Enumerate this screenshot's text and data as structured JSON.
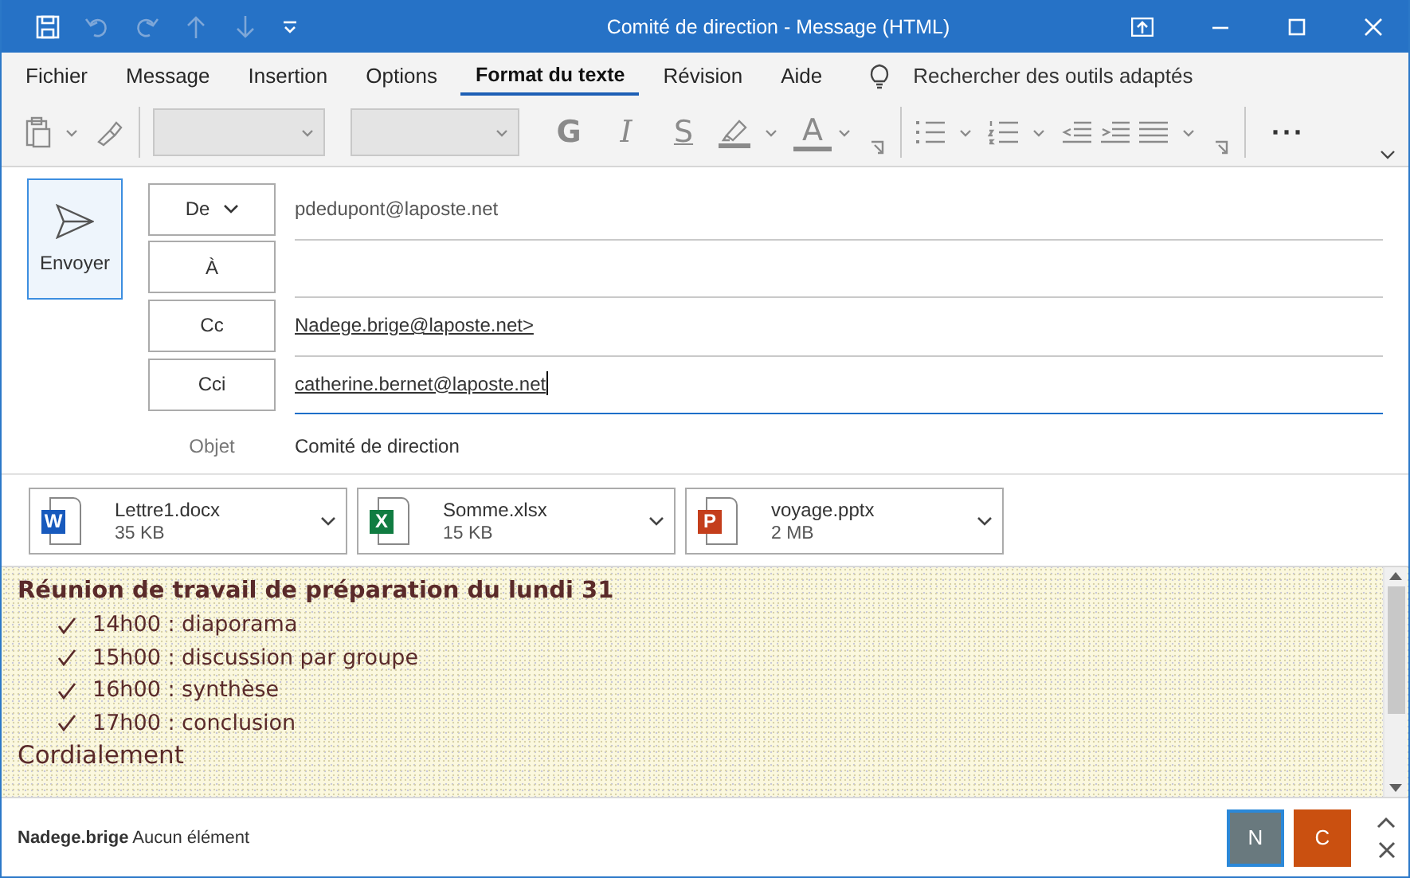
{
  "window": {
    "title": "Comité de direction  -  Message (HTML)"
  },
  "tabs": [
    {
      "label": "Fichier",
      "selected": false
    },
    {
      "label": "Message",
      "selected": false
    },
    {
      "label": "Insertion",
      "selected": false
    },
    {
      "label": "Options",
      "selected": false
    },
    {
      "label": "Format du texte",
      "selected": true
    },
    {
      "label": "Révision",
      "selected": false
    },
    {
      "label": "Aide",
      "selected": false
    }
  ],
  "search": {
    "label": "Rechercher des outils adaptés"
  },
  "format_buttons": [
    {
      "kind": "bold",
      "label": "G"
    },
    {
      "kind": "italic",
      "label": "I"
    },
    {
      "kind": "strike",
      "label": "S"
    },
    {
      "kind": "highlight"
    },
    {
      "kind": "color",
      "label": "A"
    }
  ],
  "more_button": {
    "label": "···"
  },
  "send_button": {
    "label": "Envoyer"
  },
  "fields": [
    {
      "kind": "dropdown",
      "label": "De",
      "value": "pdedupont@laposte.net",
      "link": false,
      "focused": false
    },
    {
      "kind": "button",
      "label": "À",
      "focused": false
    },
    {
      "kind": "button",
      "label": "Cc",
      "value": "Nadege.brige@laposte.net>",
      "link": true,
      "focused": false
    },
    {
      "kind": "button",
      "label": "Cci",
      "value": "catherine.bernet@laposte.net",
      "link": true,
      "focused": true
    },
    {
      "kind": "plain",
      "label": "Objet",
      "value": "Comité de direction",
      "link": false,
      "focused": false
    }
  ],
  "attachments": [
    {
      "kind": "word",
      "badge": "W",
      "name": "Lettre1.docx",
      "size": "35 KB"
    },
    {
      "kind": "excel",
      "badge": "X",
      "name": "Somme.xlsx",
      "size": "15 KB"
    },
    {
      "kind": "powerpoint",
      "badge": "P",
      "name": "voyage.pptx",
      "size": "2 MB"
    }
  ],
  "body": {
    "heading": "Réunion de travail de préparation du lundi 31",
    "items": [
      "14h00 : diaporama",
      "15h00 : discussion par groupe",
      "16h00 : synthèse",
      "17h00 : conclusion"
    ],
    "closing": "Cordialement"
  },
  "footer": {
    "sender": "Nadege.brige",
    "status": "Aucun élément",
    "contacts": [
      {
        "initial": "N",
        "color": "#69797e",
        "selected": true
      },
      {
        "initial": "C",
        "color": "#ca5010",
        "selected": false
      }
    ]
  }
}
